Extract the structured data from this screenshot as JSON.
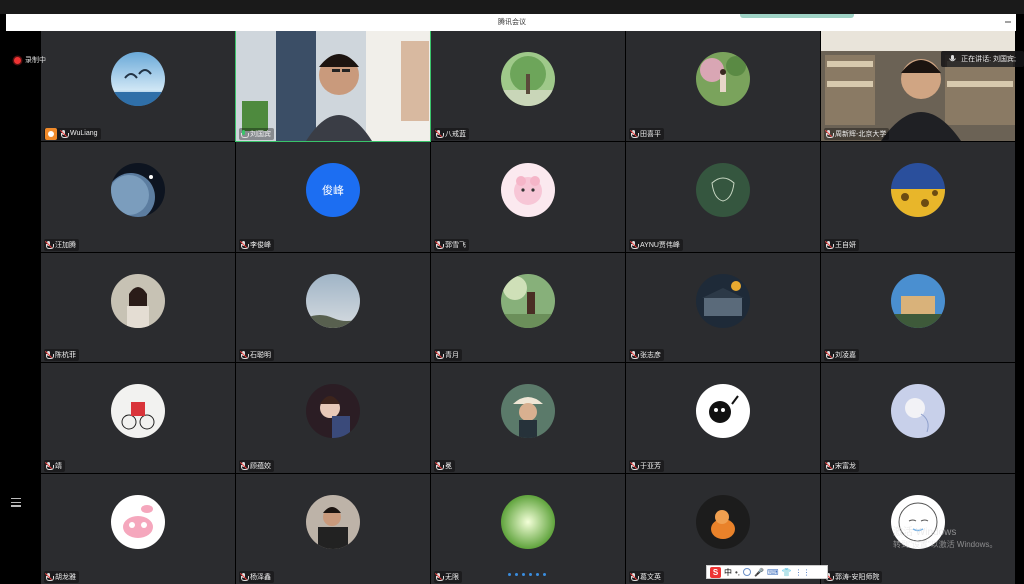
{
  "window": {
    "title": "腾讯会议"
  },
  "recording": {
    "label": "录制中"
  },
  "speaking": {
    "label": "正在讲话: 刘国宾;"
  },
  "watermark": {
    "line1": "激活 Windows",
    "line2": "转到\"设置\"以激活 Windows。"
  },
  "ime": {
    "brand": "S",
    "mode": "中"
  },
  "pager": {
    "pages": 6
  },
  "participants": [
    {
      "name": "WuLiang",
      "avatar": "dolphins-avatar",
      "host": true,
      "mic": "muted"
    },
    {
      "name": "刘国宾",
      "avatar": "camera-video",
      "mic": "green"
    },
    {
      "name": "八戒蓝",
      "avatar": "willow-tree-avatar",
      "mic": "muted"
    },
    {
      "name": "田喜平",
      "avatar": "girl-in-garden-avatar",
      "mic": "muted"
    },
    {
      "name": "周新辉-北京大学",
      "avatar": "camera-video-office",
      "mic": "muted"
    },
    {
      "name": "汪加腾",
      "avatar": "planet-avatar",
      "mic": "muted"
    },
    {
      "name": "李俊峰",
      "avatar_text": "俊峰",
      "mic": "muted"
    },
    {
      "name": "郭雪飞",
      "avatar": "pink-sheep-avatar",
      "mic": "muted"
    },
    {
      "name": "AYNU贾伟峰",
      "avatar": "sketch-avatar",
      "mic": "muted"
    },
    {
      "name": "王自妍",
      "avatar": "sunflowers-avatar",
      "mic": "muted"
    },
    {
      "name": "陈杭菲",
      "avatar": "girl-portrait-avatar",
      "mic": "muted"
    },
    {
      "name": "石聪明",
      "avatar": "sky-avatar",
      "mic": "muted"
    },
    {
      "name": "青月",
      "avatar": "forest-girl-avatar",
      "mic": "muted"
    },
    {
      "name": "张志彦",
      "avatar": "palace-avatar",
      "mic": "muted"
    },
    {
      "name": "刘凌嘉",
      "avatar": "castle-avatar",
      "mic": "muted"
    },
    {
      "name": "靖",
      "avatar": "cartoon-bicycle-avatar",
      "mic": "muted"
    },
    {
      "name": "顾蕴姣",
      "avatar": "anime-girl-avatar",
      "mic": "muted"
    },
    {
      "name": "冕",
      "avatar": "hat-girl-avatar",
      "mic": "muted"
    },
    {
      "name": "于亚芳",
      "avatar": "black-creature-avatar",
      "mic": "muted"
    },
    {
      "name": "宋富龙",
      "avatar": "sketch-girl-avatar",
      "mic": "muted"
    },
    {
      "name": "胡龙雅",
      "avatar": "pink-bunny-avatar",
      "mic": "muted"
    },
    {
      "name": "杨泽鑫",
      "avatar": "man-photo-avatar",
      "mic": "muted"
    },
    {
      "name": "无限",
      "avatar": "green-leaves-avatar",
      "mic": "muted"
    },
    {
      "name": "葛文英",
      "avatar": "orange-figure-avatar",
      "mic": "muted"
    },
    {
      "name": "郭涛-安阳师院",
      "avatar": "cartoon-face-avatar",
      "mic": "muted"
    }
  ]
}
